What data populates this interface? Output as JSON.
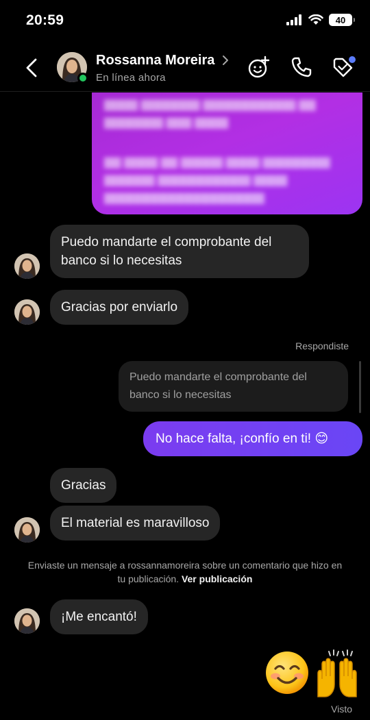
{
  "status_bar": {
    "time": "20:59",
    "battery": "40"
  },
  "header": {
    "name": "Rossanna Moreira",
    "status": "En línea ahora"
  },
  "messages": {
    "m1": "Puedo mandarte el comprobante del banco si lo necesitas",
    "m2": "Gracias por enviarlo",
    "reply_label": "Respondiste",
    "reply_quote": "Puedo mandarte el comprobante del banco si lo necesitas",
    "m3": "No hace falta, ¡confío en ti! 😊",
    "m4": "Gracias",
    "m5": "El material es maravilloso",
    "notice_text": "Enviaste un mensaje a rossannamoreira sobre un comentario que hizo en tu publicación.",
    "notice_link": "Ver publicación",
    "m6": "¡Me encantó!",
    "emoji_reply": "😊🙌",
    "seen": "Visto"
  },
  "colors": {
    "accent": "#7b3cf0",
    "incoming_bubble": "#262626",
    "online": "#22c55e"
  },
  "icons": [
    "back-icon",
    "chevron-right-icon",
    "add-effect-icon",
    "phone-icon",
    "tag-icon"
  ]
}
